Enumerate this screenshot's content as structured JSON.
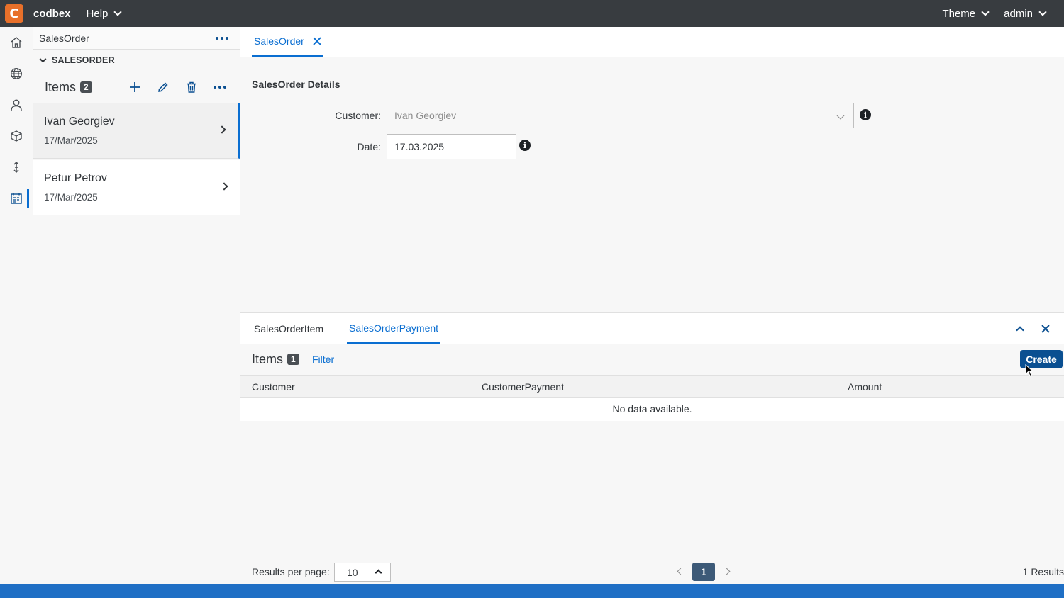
{
  "topbar": {
    "logo_letter": "C",
    "brand": "codbex",
    "help_label": "Help",
    "theme_label": "Theme",
    "user_label": "admin"
  },
  "rail": {
    "items": [
      "home-icon",
      "globe-icon",
      "user-icon",
      "package-icon",
      "transport-icon",
      "sales-order-icon"
    ],
    "active_index": 5
  },
  "list_panel": {
    "header_title": "SalesOrder",
    "section_title": "SALESORDER",
    "items_title": "Items",
    "items_count": "2",
    "items": [
      {
        "name": "Ivan Georgiev",
        "date": "17/Mar/2025",
        "selected": true
      },
      {
        "name": "Petur Petrov",
        "date": "17/Mar/2025",
        "selected": false
      }
    ]
  },
  "main": {
    "tab_label": "SalesOrder",
    "details_title": "SalesOrder Details",
    "form": {
      "customer_label": "Customer:",
      "customer_value": "Ivan Georgiev",
      "date_label": "Date:",
      "date_value": "17.03.2025"
    },
    "subtabs": [
      "SalesOrderItem",
      "SalesOrderPayment"
    ],
    "active_subtab": "SalesOrderPayment",
    "table": {
      "title": "Items",
      "count": "1",
      "filter_label": "Filter",
      "create_label": "Create",
      "columns": [
        "Customer",
        "CustomerPayment",
        "Amount"
      ],
      "empty_text": "No data available."
    },
    "footer": {
      "results_per_page_label": "Results per page:",
      "results_per_page_value": "10",
      "current_page": "1",
      "results_text": "1 Results"
    }
  },
  "colors": {
    "accent": "#0a6ed1",
    "topbar": "#383c40",
    "logo": "#e8702a",
    "primary_button": "#0a4f91",
    "status_bar": "#1f6fc5"
  }
}
